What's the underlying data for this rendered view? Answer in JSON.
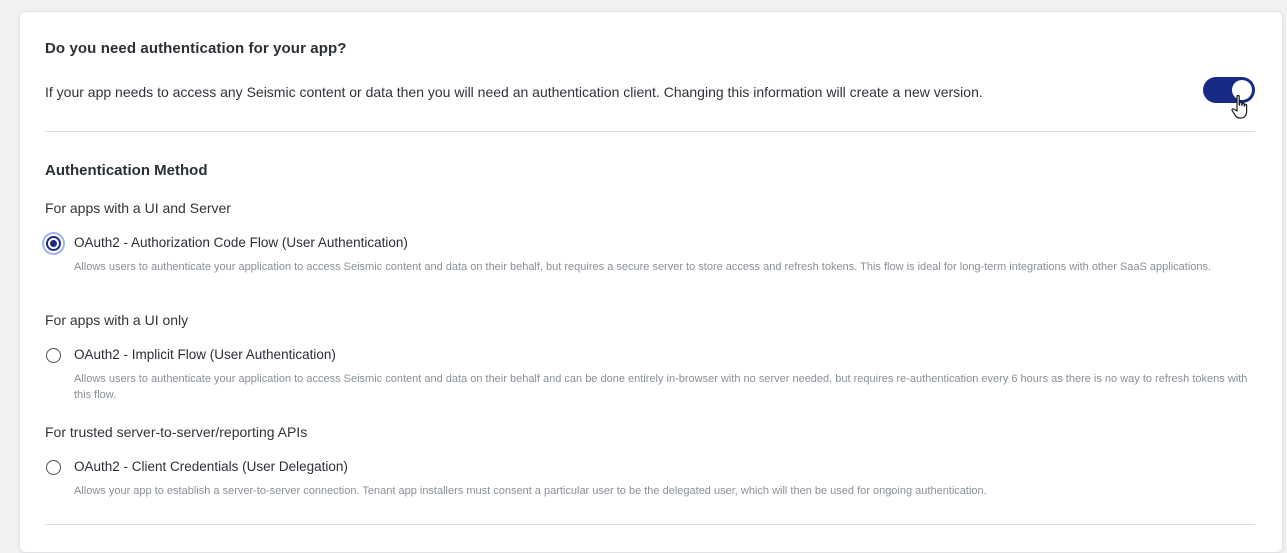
{
  "auth_section": {
    "title": "Do you need authentication for your app?",
    "description": "If your app needs to access any Seismic content or data then you will need an authentication client. Changing this information will create a new version.",
    "toggle_on": true
  },
  "method_section": {
    "title": "Authentication Method",
    "groups": [
      {
        "label": "For apps with a UI and Server",
        "option": {
          "label": "OAuth2 - Authorization Code Flow (User Authentication)",
          "help": "Allows users to authenticate your application to access Seismic content and data on their behalf, but requires a secure server to store access and refresh tokens. This flow is ideal for long-term integrations with other SaaS applications.",
          "selected": true
        }
      },
      {
        "label": "For apps with a UI only",
        "option": {
          "label": "OAuth2 - Implicit Flow (User Authentication)",
          "help": "Allows users to authenticate your application to access Seismic content and data on their behalf and can be done entirely in-browser with no server needed, but requires re-authentication every 6 hours as there is no way to refresh tokens with this flow.",
          "selected": false
        }
      },
      {
        "label": "For trusted server-to-server/reporting APIs",
        "option": {
          "label": "OAuth2 - Client Credentials (User Delegation)",
          "help": "Allows your app to establish a server-to-server connection. Tenant app installers must consent a particular user to be the delegated user, which will then be used for ongoing authentication.",
          "selected": false
        }
      }
    ]
  },
  "colors": {
    "accent": "#172b86",
    "focus_ring": "#9fb2ee",
    "help_text": "#8a8f98"
  }
}
